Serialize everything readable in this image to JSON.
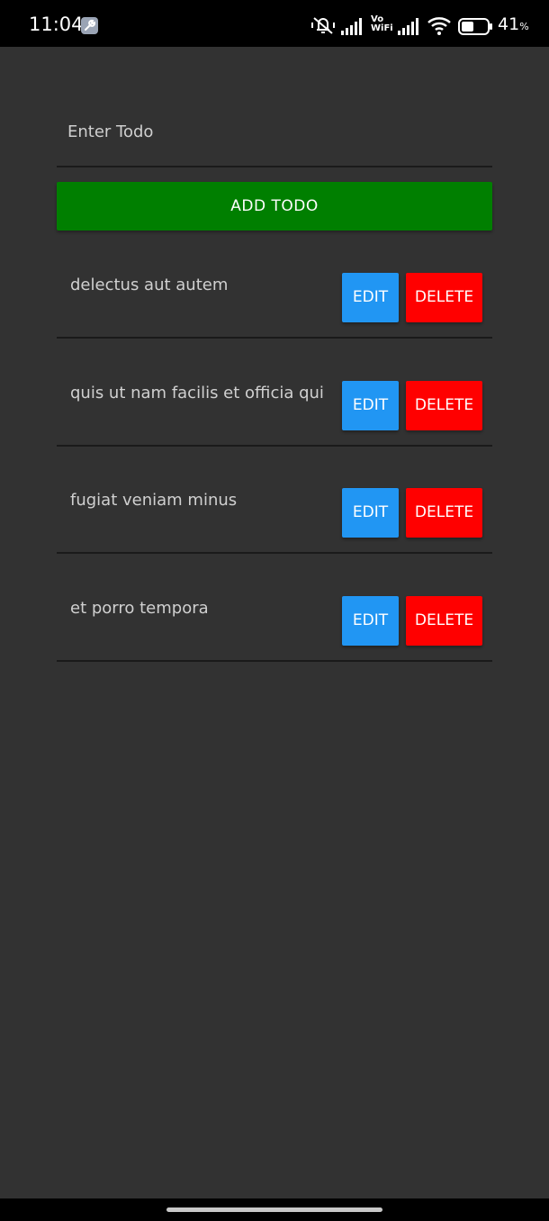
{
  "status_bar": {
    "time": "11:04",
    "network_label_top": "Vo",
    "network_label_bottom": "WiFi",
    "battery_percent": "41",
    "battery_unit": "%",
    "icons": [
      "wrench-icon",
      "mute-vibrate-icon",
      "signal-icon",
      "signal-icon",
      "wifi-icon",
      "battery-icon"
    ]
  },
  "form": {
    "input_placeholder": "Enter Todo",
    "add_label": "ADD TODO"
  },
  "todos": [
    {
      "text": "delectus aut autem",
      "edit_label": "EDIT",
      "delete_label": "DELETE"
    },
    {
      "text": "quis ut nam facilis et officia qui",
      "edit_label": "EDIT",
      "delete_label": "DELETE"
    },
    {
      "text": "fugiat veniam minus",
      "edit_label": "EDIT",
      "delete_label": "DELETE"
    },
    {
      "text": "et porro tempora",
      "edit_label": "EDIT",
      "delete_label": "DELETE"
    }
  ],
  "colors": {
    "background": "#323232",
    "add_button": "#007f00",
    "edit_button": "#2196f3",
    "delete_button": "#ff0000"
  }
}
